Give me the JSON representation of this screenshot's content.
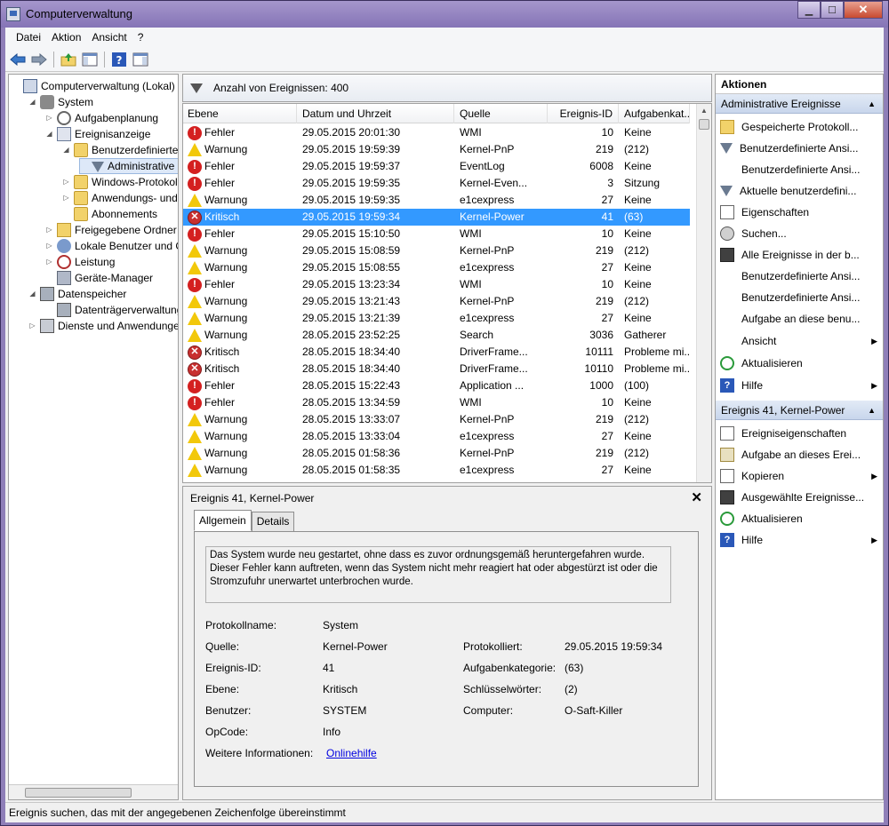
{
  "window": {
    "title": "Computerverwaltung",
    "min": "▁",
    "max": "☐",
    "close": "✕"
  },
  "menu": [
    "Datei",
    "Aktion",
    "Ansicht",
    "?"
  ],
  "tree": [
    {
      "label": "Computerverwaltung (Lokal)",
      "level": 0,
      "exp": "",
      "icon": "computer-icon"
    },
    {
      "label": "System",
      "level": 1,
      "exp": "◢",
      "icon": "tools-icon"
    },
    {
      "label": "Aufgabenplanung",
      "level": 2,
      "exp": "▷",
      "icon": "clock-icon"
    },
    {
      "label": "Ereignisanzeige",
      "level": 2,
      "exp": "◢",
      "icon": "event-log-icon"
    },
    {
      "label": "Benutzerdefinierte A",
      "level": 3,
      "exp": "◢",
      "icon": "folder-icon"
    },
    {
      "label": "Administrative E",
      "level": 4,
      "exp": "",
      "icon": "filter-icon",
      "selected": true
    },
    {
      "label": "Windows-Protokolle",
      "level": 3,
      "exp": "▷",
      "icon": "folder-icon"
    },
    {
      "label": "Anwendungs- und D",
      "level": 3,
      "exp": "▷",
      "icon": "folder-icon"
    },
    {
      "label": "Abonnements",
      "level": 3,
      "exp": "",
      "icon": "folder-icon"
    },
    {
      "label": "Freigegebene Ordner",
      "level": 2,
      "exp": "▷",
      "icon": "shared-folder-icon"
    },
    {
      "label": "Lokale Benutzer und Gr",
      "level": 2,
      "exp": "▷",
      "icon": "users-icon"
    },
    {
      "label": "Leistung",
      "level": 2,
      "exp": "▷",
      "icon": "performance-icon"
    },
    {
      "label": "Geräte-Manager",
      "level": 2,
      "exp": "",
      "icon": "device-manager-icon"
    },
    {
      "label": "Datenspeicher",
      "level": 1,
      "exp": "◢",
      "icon": "storage-icon"
    },
    {
      "label": "Datenträgerverwaltung",
      "level": 2,
      "exp": "",
      "icon": "disk-icon"
    },
    {
      "label": "Dienste und Anwendungen",
      "level": 1,
      "exp": "▷",
      "icon": "services-icon"
    }
  ],
  "events": {
    "count_label": "Anzahl von Ereignissen: 400",
    "columns": [
      "Ebene",
      "Datum und Uhrzeit",
      "Quelle",
      "Ereignis-ID",
      "Aufgabenkat..."
    ],
    "rows": [
      {
        "level": "Fehler",
        "type": "err",
        "date": "29.05.2015 20:01:30",
        "source": "WMI",
        "id": "10",
        "cat": "Keine"
      },
      {
        "level": "Warnung",
        "type": "warn",
        "date": "29.05.2015 19:59:39",
        "source": "Kernel-PnP",
        "id": "219",
        "cat": "(212)"
      },
      {
        "level": "Fehler",
        "type": "err",
        "date": "29.05.2015 19:59:37",
        "source": "EventLog",
        "id": "6008",
        "cat": "Keine"
      },
      {
        "level": "Fehler",
        "type": "err",
        "date": "29.05.2015 19:59:35",
        "source": "Kernel-Even...",
        "id": "3",
        "cat": "Sitzung"
      },
      {
        "level": "Warnung",
        "type": "warn",
        "date": "29.05.2015 19:59:35",
        "source": "e1cexpress",
        "id": "27",
        "cat": "Keine"
      },
      {
        "level": "Kritisch",
        "type": "crit",
        "date": "29.05.2015 19:59:34",
        "source": "Kernel-Power",
        "id": "41",
        "cat": "(63)",
        "selected": true
      },
      {
        "level": "Fehler",
        "type": "err",
        "date": "29.05.2015 15:10:50",
        "source": "WMI",
        "id": "10",
        "cat": "Keine"
      },
      {
        "level": "Warnung",
        "type": "warn",
        "date": "29.05.2015 15:08:59",
        "source": "Kernel-PnP",
        "id": "219",
        "cat": "(212)"
      },
      {
        "level": "Warnung",
        "type": "warn",
        "date": "29.05.2015 15:08:55",
        "source": "e1cexpress",
        "id": "27",
        "cat": "Keine"
      },
      {
        "level": "Fehler",
        "type": "err",
        "date": "29.05.2015 13:23:34",
        "source": "WMI",
        "id": "10",
        "cat": "Keine"
      },
      {
        "level": "Warnung",
        "type": "warn",
        "date": "29.05.2015 13:21:43",
        "source": "Kernel-PnP",
        "id": "219",
        "cat": "(212)"
      },
      {
        "level": "Warnung",
        "type": "warn",
        "date": "29.05.2015 13:21:39",
        "source": "e1cexpress",
        "id": "27",
        "cat": "Keine"
      },
      {
        "level": "Warnung",
        "type": "warn",
        "date": "28.05.2015 23:52:25",
        "source": "Search",
        "id": "3036",
        "cat": "Gatherer"
      },
      {
        "level": "Kritisch",
        "type": "crit",
        "date": "28.05.2015 18:34:40",
        "source": "DriverFrame...",
        "id": "10111",
        "cat": "Probleme mi..."
      },
      {
        "level": "Kritisch",
        "type": "crit",
        "date": "28.05.2015 18:34:40",
        "source": "DriverFrame...",
        "id": "10110",
        "cat": "Probleme mi..."
      },
      {
        "level": "Fehler",
        "type": "err",
        "date": "28.05.2015 15:22:43",
        "source": "Application ...",
        "id": "1000",
        "cat": "(100)"
      },
      {
        "level": "Fehler",
        "type": "err",
        "date": "28.05.2015 13:34:59",
        "source": "WMI",
        "id": "10",
        "cat": "Keine"
      },
      {
        "level": "Warnung",
        "type": "warn",
        "date": "28.05.2015 13:33:07",
        "source": "Kernel-PnP",
        "id": "219",
        "cat": "(212)"
      },
      {
        "level": "Warnung",
        "type": "warn",
        "date": "28.05.2015 13:33:04",
        "source": "e1cexpress",
        "id": "27",
        "cat": "Keine"
      },
      {
        "level": "Warnung",
        "type": "warn",
        "date": "28.05.2015 01:58:36",
        "source": "Kernel-PnP",
        "id": "219",
        "cat": "(212)"
      },
      {
        "level": "Warnung",
        "type": "warn",
        "date": "28.05.2015 01:58:35",
        "source": "e1cexpress",
        "id": "27",
        "cat": "Keine"
      }
    ]
  },
  "detail": {
    "title": "Ereignis 41, Kernel-Power",
    "tabs": [
      "Allgemein",
      "Details"
    ],
    "description": "Das System wurde neu gestartet, ohne dass es zuvor ordnungsgemäß heruntergefahren wurde. Dieser Fehler kann auftreten, wenn das System nicht mehr reagiert hat oder abgestürzt ist oder die Stromzufuhr unerwartet unterbrochen wurde.",
    "fields": {
      "protokollname_label": "Protokollname:",
      "protokollname": "System",
      "quelle_label": "Quelle:",
      "quelle": "Kernel-Power",
      "protokolliert_label": "Protokolliert:",
      "protokolliert": "29.05.2015 19:59:34",
      "id_label": "Ereignis-ID:",
      "id": "41",
      "kategorie_label": "Aufgabenkategorie:",
      "kategorie": "(63)",
      "ebene_label": "Ebene:",
      "ebene": "Kritisch",
      "keywords_label": "Schlüsselwörter:",
      "keywords": "(2)",
      "benutzer_label": "Benutzer:",
      "benutzer": "SYSTEM",
      "computer_label": "Computer:",
      "computer": "O-Saft-Killer",
      "opcode_label": "OpCode:",
      "opcode": "Info",
      "info_label": "Weitere Informationen:",
      "info_link": "Onlinehilfe"
    }
  },
  "actions": {
    "header": "Aktionen",
    "section1": "Administrative Ereignisse",
    "items1": [
      {
        "label": "Gespeicherte Protokoll...",
        "icon": "open-log-icon",
        "sub": false
      },
      {
        "label": "Benutzerdefinierte Ansi...",
        "icon": "filter-icon",
        "sub": false
      },
      {
        "label": "Benutzerdefinierte Ansi...",
        "icon": "",
        "sub": false
      },
      {
        "label": "Aktuelle benutzerdefini...",
        "icon": "filter-icon",
        "sub": false
      },
      {
        "label": "Eigenschaften",
        "icon": "properties-icon",
        "sub": false
      },
      {
        "label": "Suchen...",
        "icon": "find-icon",
        "sub": false
      },
      {
        "label": "Alle Ereignisse in der b...",
        "icon": "save-icon",
        "sub": false
      },
      {
        "label": "Benutzerdefinierte Ansi...",
        "icon": "",
        "sub": false
      },
      {
        "label": "Benutzerdefinierte Ansi...",
        "icon": "",
        "sub": false
      },
      {
        "label": "Aufgabe an diese benu...",
        "icon": "",
        "sub": false
      },
      {
        "label": "Ansicht",
        "icon": "",
        "sub": true
      },
      {
        "label": "Aktualisieren",
        "icon": "refresh-icon",
        "sub": false
      },
      {
        "label": "Hilfe",
        "icon": "help-icon",
        "sub": true
      }
    ],
    "section2": "Ereignis 41, Kernel-Power",
    "items2": [
      {
        "label": "Ereigniseigenschaften",
        "icon": "properties-icon",
        "sub": false
      },
      {
        "label": "Aufgabe an dieses Erei...",
        "icon": "task-icon",
        "sub": false
      },
      {
        "label": "Kopieren",
        "icon": "copy-icon",
        "sub": true
      },
      {
        "label": "Ausgewählte Ereignisse...",
        "icon": "save-icon",
        "sub": false
      },
      {
        "label": "Aktualisieren",
        "icon": "refresh-icon",
        "sub": false
      },
      {
        "label": "Hilfe",
        "icon": "help-icon",
        "sub": true
      }
    ]
  },
  "status": "Ereignis suchen, das mit der angegebenen Zeichenfolge übereinstimmt",
  "colors": {
    "selection": "#3399ff",
    "section": "#c8d6ec",
    "title": "#8574b6"
  }
}
